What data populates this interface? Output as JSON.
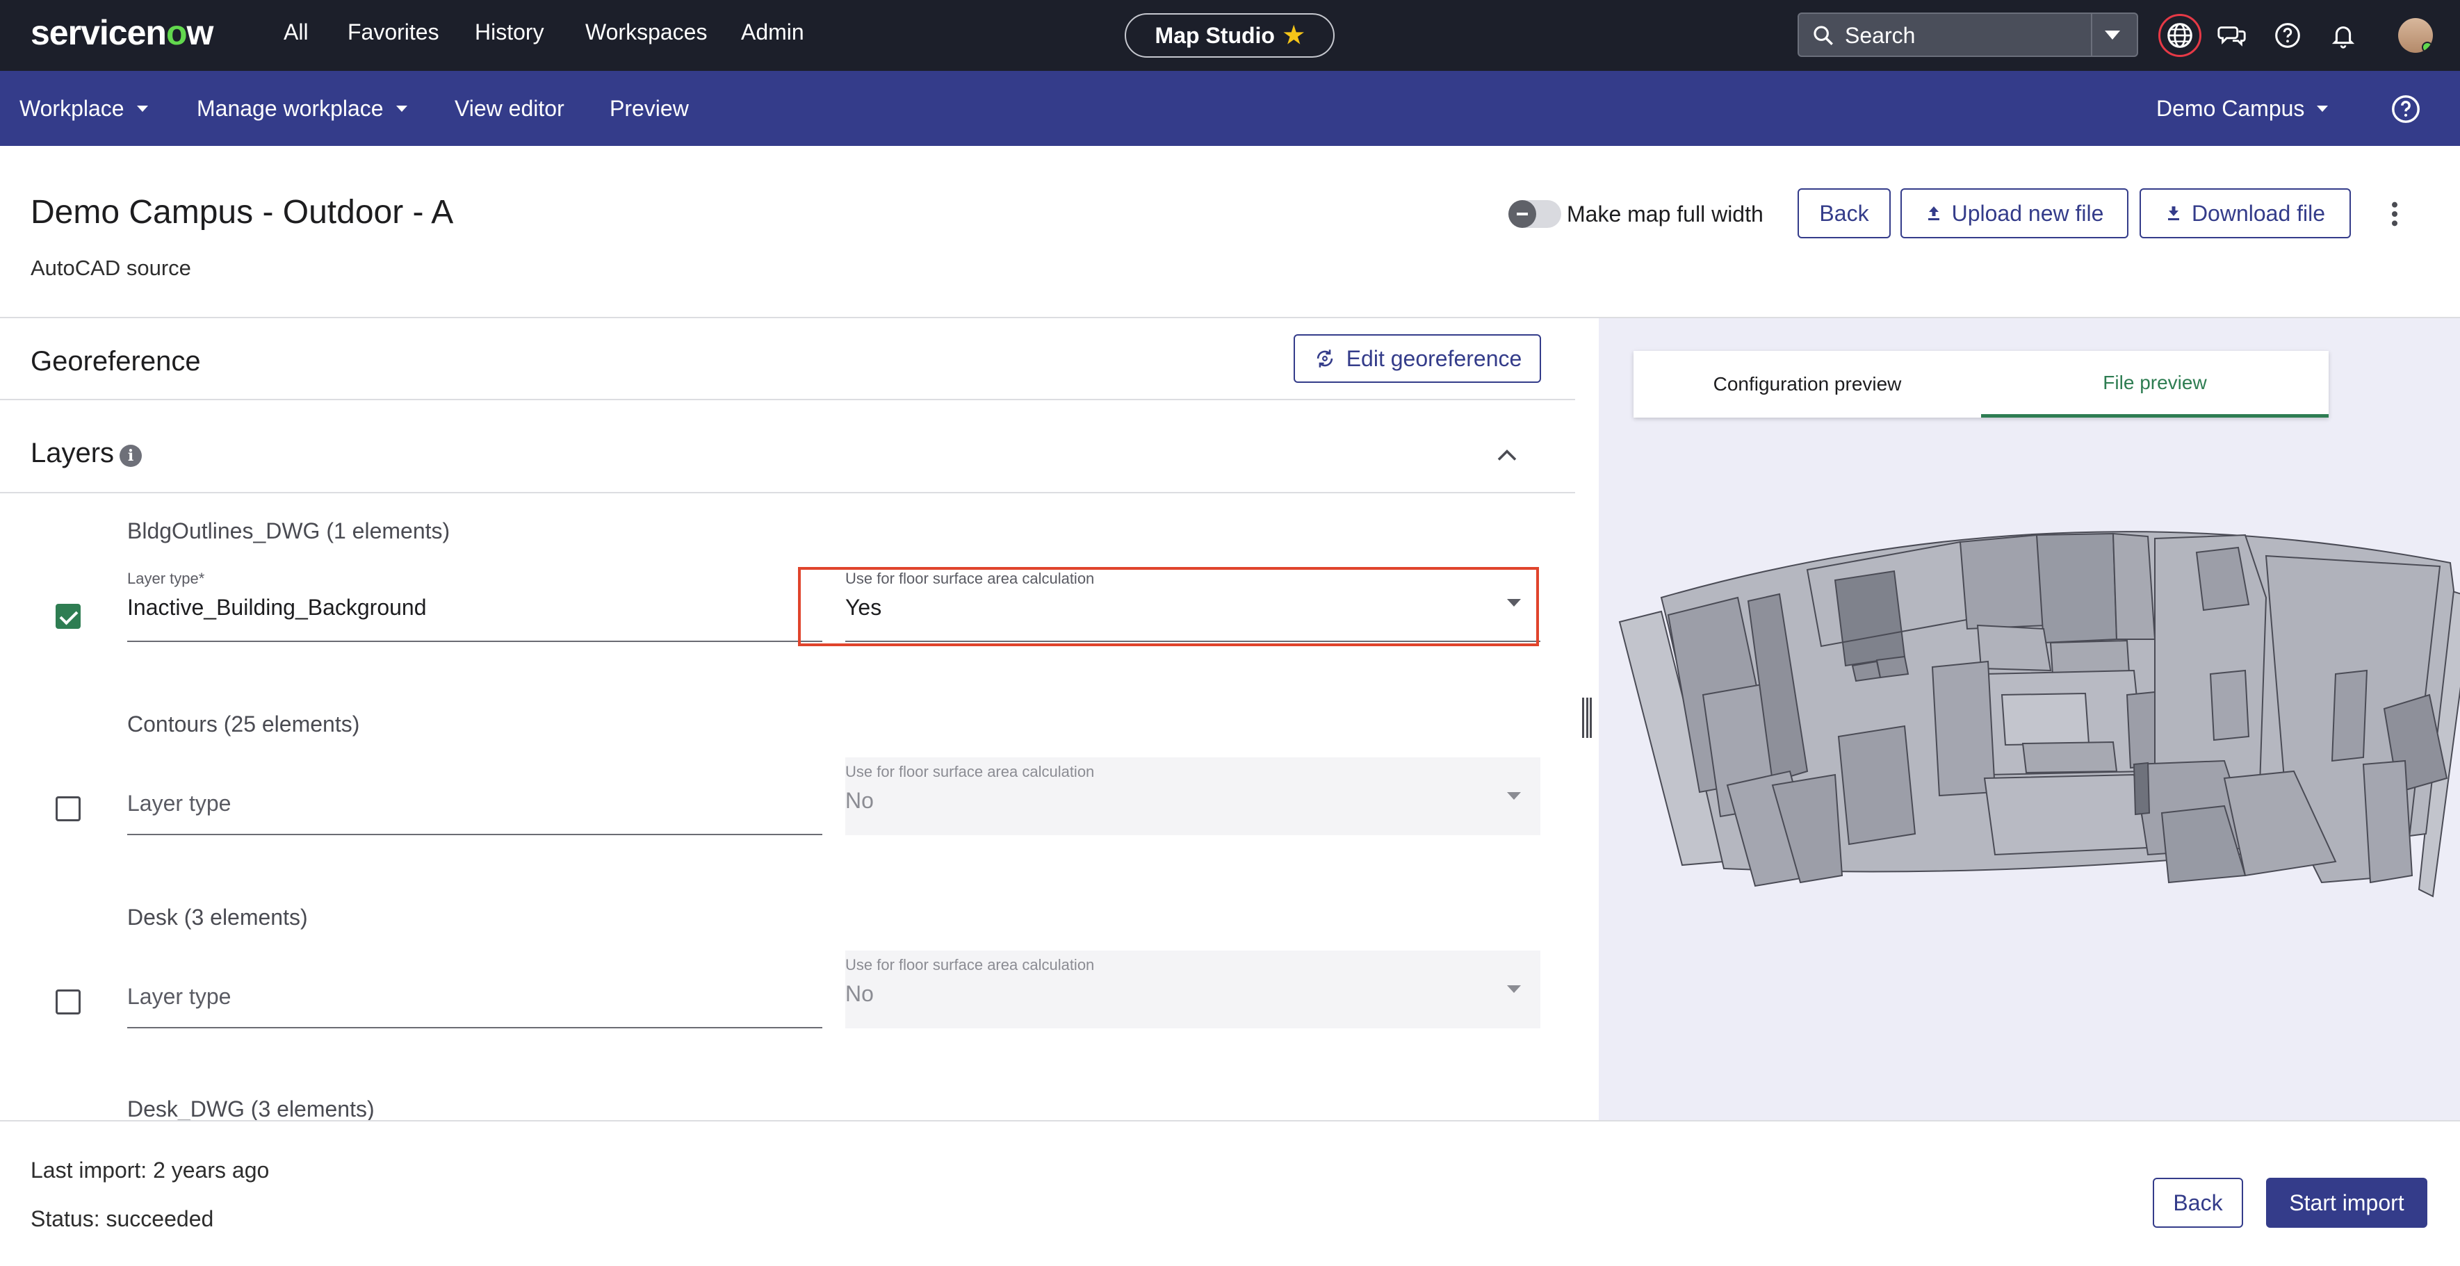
{
  "topnav": {
    "logo": "servicenow",
    "items": [
      "All",
      "Favorites",
      "History",
      "Workspaces",
      "Admin"
    ],
    "studio_label": "Map Studio",
    "search_placeholder": "Search"
  },
  "subnav": {
    "items": [
      "Workplace",
      "Manage workplace",
      "View editor",
      "Preview"
    ],
    "campus": "Demo Campus"
  },
  "header": {
    "title": "Demo Campus - Outdoor - A",
    "subtitle": "AutoCAD source",
    "toggle_label": "Make map full width",
    "back_label": "Back",
    "upload_label": "Upload new file",
    "download_label": "Download file"
  },
  "georeference": {
    "title": "Georeference",
    "edit_label": "Edit georeference"
  },
  "layers": {
    "title": "Layers",
    "items": [
      {
        "name": "BldgOutlines_DWG (1 elements)",
        "checked": true,
        "type_label": "Layer type*",
        "type_value": "Inactive_Building_Background",
        "calc_label": "Use for floor surface area calculation",
        "calc_value": "Yes"
      },
      {
        "name": "Contours (25 elements)",
        "checked": false,
        "type_placeholder": "Layer type",
        "calc_label": "Use for floor surface area calculation",
        "calc_value": "No"
      },
      {
        "name": "Desk (3 elements)",
        "checked": false,
        "type_placeholder": "Layer type",
        "calc_label": "Use for floor surface area calculation",
        "calc_value": "No"
      },
      {
        "name": "Desk_DWG (3 elements)"
      }
    ]
  },
  "preview": {
    "tabs": [
      "Configuration preview",
      "File preview"
    ],
    "active_tab": "File preview"
  },
  "footer": {
    "last_import": "Last import: 2 years ago",
    "status": "Status: succeeded",
    "back_label": "Back",
    "start_label": "Start import"
  },
  "colors": {
    "topnav_bg": "#1c1f2a",
    "subnav_bg": "#343c8a",
    "accent_green": "#2e7d52",
    "highlight_red": "#e0442c",
    "map_bg": "#ededf7"
  }
}
